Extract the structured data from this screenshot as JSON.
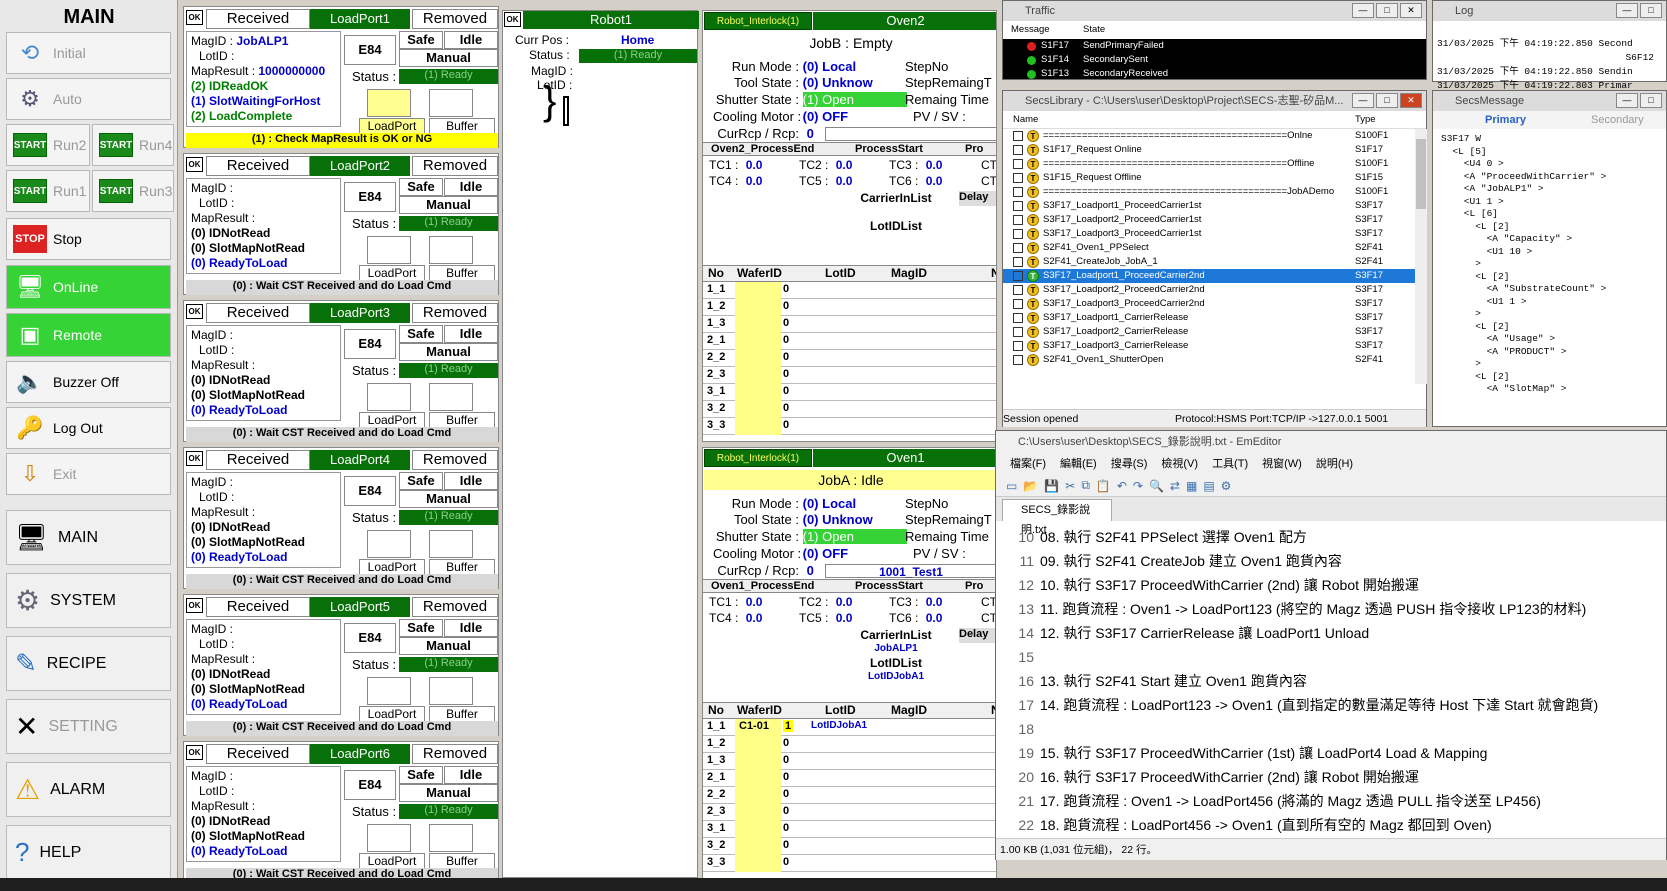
{
  "menu": {
    "title": "MAIN",
    "initial": "Initial",
    "auto": "Auto",
    "start_icon": "START",
    "run2": "Run2",
    "run4": "Run4",
    "run1": "Run1",
    "run3": "Run3",
    "stop_icon": "STOP",
    "stop": "Stop",
    "online": "OnLine",
    "remote": "Remote",
    "buzzer": "Buzzer Off",
    "logout": "Log Out",
    "exit": "Exit",
    "main": "MAIN",
    "system": "SYSTEM",
    "recipe": "RECIPE",
    "setting": "SETTING",
    "alarm": "ALARM",
    "help": "HELP"
  },
  "lp_common": {
    "ok": "OK",
    "received": "Received",
    "removed": "Removed",
    "magid_label": "MagID :",
    "lotid_label": "LotID :",
    "mapresult_label": "MapResult :",
    "e84": "E84",
    "safe": "Safe",
    "idle": "Idle",
    "manual": "Manual",
    "status_label": "Status :",
    "ready": "(1) Ready",
    "loadport_btn": "LoadPort",
    "buffer_btn": "Buffer"
  },
  "loadports": [
    {
      "name": "LoadPort1",
      "magid": "JobALP1",
      "mapresult": "1000000000",
      "l1": "(2) IDReadOK",
      "l2": "(1) SlotWaitingForHost",
      "l3": "(2) LoadComplete",
      "msg": "(1) : Check MapResult is OK or NG"
    },
    {
      "name": "LoadPort2",
      "magid": "",
      "mapresult": "",
      "l1": "(0) IDNotRead",
      "l2": "(0) SlotMapNotRead",
      "l3": "(0) ReadyToLoad",
      "msg": "(0) : Wait CST Received and do Load Cmd"
    },
    {
      "name": "LoadPort3",
      "magid": "",
      "mapresult": "",
      "l1": "(0) IDNotRead",
      "l2": "(0) SlotMapNotRead",
      "l3": "(0) ReadyToLoad",
      "msg": "(0) : Wait CST Received and do Load Cmd"
    },
    {
      "name": "LoadPort4",
      "magid": "",
      "mapresult": "",
      "l1": "(0) IDNotRead",
      "l2": "(0) SlotMapNotRead",
      "l3": "(0) ReadyToLoad",
      "msg": "(0) : Wait CST Received and do Load Cmd"
    },
    {
      "name": "LoadPort5",
      "magid": "",
      "mapresult": "",
      "l1": "(0) IDNotRead",
      "l2": "(0) SlotMapNotRead",
      "l3": "(0) ReadyToLoad",
      "msg": "(0) : Wait CST Received and do Load Cmd"
    },
    {
      "name": "LoadPort6",
      "magid": "",
      "mapresult": "",
      "l1": "(0) IDNotRead",
      "l2": "(0) SlotMapNotRead",
      "l3": "(0) ReadyToLoad",
      "msg": "(0) : Wait CST Received and do Load Cmd"
    }
  ],
  "robot": {
    "ok": "OK",
    "title": "Robot1",
    "curpos_label": "Curr Pos :",
    "curpos": "Home",
    "status_label": "Status :",
    "status": "(1) Ready",
    "magid_label": "MagID :",
    "lotid_label": "LotID :"
  },
  "oven_common": {
    "interlock": "Robot_Interlock(1)",
    "runmode_label": "Run Mode :",
    "runmode": "(0) Local",
    "toolstate_label": "Tool State :",
    "toolstate": "(0) Unknow",
    "shutter_label": "Shutter State :",
    "shutter": "(1) Open",
    "cooling_label": "Cooling Motor :",
    "cooling": "(0) OFF",
    "currcp_label": "CurRcp / Rcp:",
    "stepno": "StepNo",
    "stepremain": "StepRemaingT",
    "remaintime": "Remaing Time",
    "pvsv": "PV / SV :",
    "processstart": "ProcessStart",
    "pro": "Pro",
    "tc1": "TC1 :",
    "tc2": "TC2 :",
    "tc3": "TC3 :",
    "tc4": "TC4 :",
    "tc5": "TC5 :",
    "tc6": "TC6 :",
    "ct": "CT",
    "tcval": "0.0",
    "carrierinlist": "CarrierInList",
    "delay": "Delay",
    "lotidlist": "LotIDList",
    "no": "No",
    "waferid": "WaferID",
    "lotid": "LotID",
    "magid": "MagID",
    "n": "N",
    "zero": "0",
    "slots": [
      "1_1",
      "1_2",
      "1_3",
      "2_1",
      "2_2",
      "2_3",
      "3_1",
      "3_2",
      "3_3"
    ]
  },
  "oven2": {
    "name": "Oven2",
    "job": "JobB : Empty",
    "rcp_value": "0",
    "rcp_name": "",
    "processend": "Oven2_ProcessEnd",
    "carrier": "",
    "lot": ""
  },
  "oven1": {
    "name": "Oven1",
    "job": "JobA : Idle",
    "rcp_value": "0",
    "rcp_name": "1001_Test1",
    "processend": "Oven1_ProcessEnd",
    "carrier": "JobALP1",
    "lot": "LotIDJobA1",
    "wafer1": "C1-01",
    "wafer1_n": "1",
    "wafer1_lot": "LotIDJobA1"
  },
  "traffic": {
    "title": "Traffic",
    "col_message": "Message",
    "col_state": "State",
    "rows": [
      {
        "msg": "S1F17",
        "state": "SendPrimaryFailed",
        "color": "#e02020"
      },
      {
        "msg": "S1F14",
        "state": "SecondarySent",
        "color": "#20c020"
      },
      {
        "msg": "S1F13",
        "state": "SecondaryReceived",
        "color": "#20c020"
      }
    ]
  },
  "log": {
    "title": "Log",
    "lines": [
      "31/03/2025 下午 04:19:22.850 Second",
      "S6F12",
      "31/03/2025 下午 04:19:22.850 Sendin",
      "31/03/2025 下午 04:19:22.803 Primar"
    ]
  },
  "secslib": {
    "title": "SecsLibrary - C:\\Users\\user\\Desktop\\Project\\SECS-志聖-矽品M...",
    "col_name": "Name",
    "col_type": "Type",
    "rows": [
      {
        "n": "============================================Onlne",
        "t": "S100F1"
      },
      {
        "n": "S1F17_Request Online",
        "t": "S1F17"
      },
      {
        "n": "============================================Offline",
        "t": "S100F1"
      },
      {
        "n": "S1F15_Request Offline",
        "t": "S1F15"
      },
      {
        "n": "============================================JobADemo",
        "t": "S100F1"
      },
      {
        "n": "S3F17_Loadport1_ProceedCarrier1st",
        "t": "S3F17"
      },
      {
        "n": "S3F17_Loadport2_ProceedCarrier1st",
        "t": "S3F17"
      },
      {
        "n": "S3F17_Loadport3_ProceedCarrier1st",
        "t": "S3F17"
      },
      {
        "n": "S2F41_Oven1_PPSelect",
        "t": "S2F41"
      },
      {
        "n": "S2F41_CreateJob_JobA_1",
        "t": "S2F41"
      },
      {
        "n": "S3F17_Loadport1_ProceedCarrier2nd",
        "t": "S3F17"
      },
      {
        "n": "S3F17_Loadport2_ProceedCarrier2nd",
        "t": "S3F17"
      },
      {
        "n": "S3F17_Loadport3_ProceedCarrier2nd",
        "t": "S3F17"
      },
      {
        "n": "S3F17_Loadport1_CarrierRelease",
        "t": "S3F17"
      },
      {
        "n": "S3F17_Loadport2_CarrierRelease",
        "t": "S3F17"
      },
      {
        "n": "S3F17_Loadport3_CarrierRelease",
        "t": "S3F17"
      },
      {
        "n": "S2F41_Oven1_ShutterOpen",
        "t": "S2F41"
      }
    ],
    "status": "Session opened",
    "protocol": "Protocol:HSMS Port:TCP/IP ->127.0.0.1 5001"
  },
  "secsmsg": {
    "title": "SecsMessage",
    "primary": "Primary",
    "secondary": "Secondary",
    "lines": [
      "S3F17 W",
      "  <L [5]",
      "    <U4 0 >",
      "    <A \"ProceedWithCarrier\" >",
      "    <A \"JobALP1\" >",
      "    <U1 1 >",
      "    <L [6]",
      "      <L [2]",
      "        <A \"Capacity\" >",
      "        <U1 10 >",
      "      >",
      "      <L [2]",
      "        <A \"SubstrateCount\" >",
      "        <U1 1 >",
      "      >",
      "      <L [2]",
      "        <A \"Usage\" >",
      "        <A \"PRODUCT\" >",
      "      >",
      "      <L [2]",
      "        <A \"SlotMap\" >"
    ]
  },
  "editor": {
    "title": "C:\\Users\\user\\Desktop\\SECS_錄影說明.txt - EmEditor",
    "menus": [
      "檔案(F)",
      "編輯(E)",
      "搜尋(S)",
      "檢視(V)",
      "工具(T)",
      "視窗(W)",
      "說明(H)"
    ],
    "tab": "SECS_錄影說明.txt",
    "status": "1.00 KB (1,031 位元組)， 22 行。",
    "lines": [
      {
        "n": "10",
        "t": "08. 執行 S2F41 PPSelect 選擇 Oven1 配方"
      },
      {
        "n": "11",
        "t": "09. 執行 S2F41 CreateJob 建立 Oven1 跑貨內容"
      },
      {
        "n": "12",
        "t": "10. 執行 S3F17 ProceedWithCarrier (2nd) 讓 Robot 開始搬運"
      },
      {
        "n": "13",
        "t": "11. 跑貨流程 : Oven1 -> LoadPort123 (將空的 Magz 透過 PUSH 指令接收 LP123的材料)"
      },
      {
        "n": "14",
        "t": "12. 執行 S3F17 CarrierRelease 讓 LoadPort1 Unload"
      },
      {
        "n": "15",
        "t": ""
      },
      {
        "n": "16",
        "t": "13. 執行 S2F41 Start 建立 Oven1 跑貨內容"
      },
      {
        "n": "17",
        "t": "14. 跑貨流程 : LoadPort123 -> Oven1 (直到指定的數量滿足等待 Host 下達 Start 就會跑貨)"
      },
      {
        "n": "18",
        "t": ""
      },
      {
        "n": "19",
        "t": "15. 執行 S3F17 ProceedWithCarrier (1st) 讓 LoadPort4 Load & Mapping"
      },
      {
        "n": "20",
        "t": "16. 執行 S3F17 ProceedWithCarrier (2nd) 讓 Robot 開始搬運"
      },
      {
        "n": "21",
        "t": "17. 跑貨流程 : Oven1 -> LoadPort456 (將滿的 Magz 透過 PULL 指令送至 LP456)"
      },
      {
        "n": "22",
        "t": "18. 跑貨流程 : LoadPort456 -> Oven1 (直到所有空的 Magz 都回到 Oven)"
      }
    ]
  }
}
